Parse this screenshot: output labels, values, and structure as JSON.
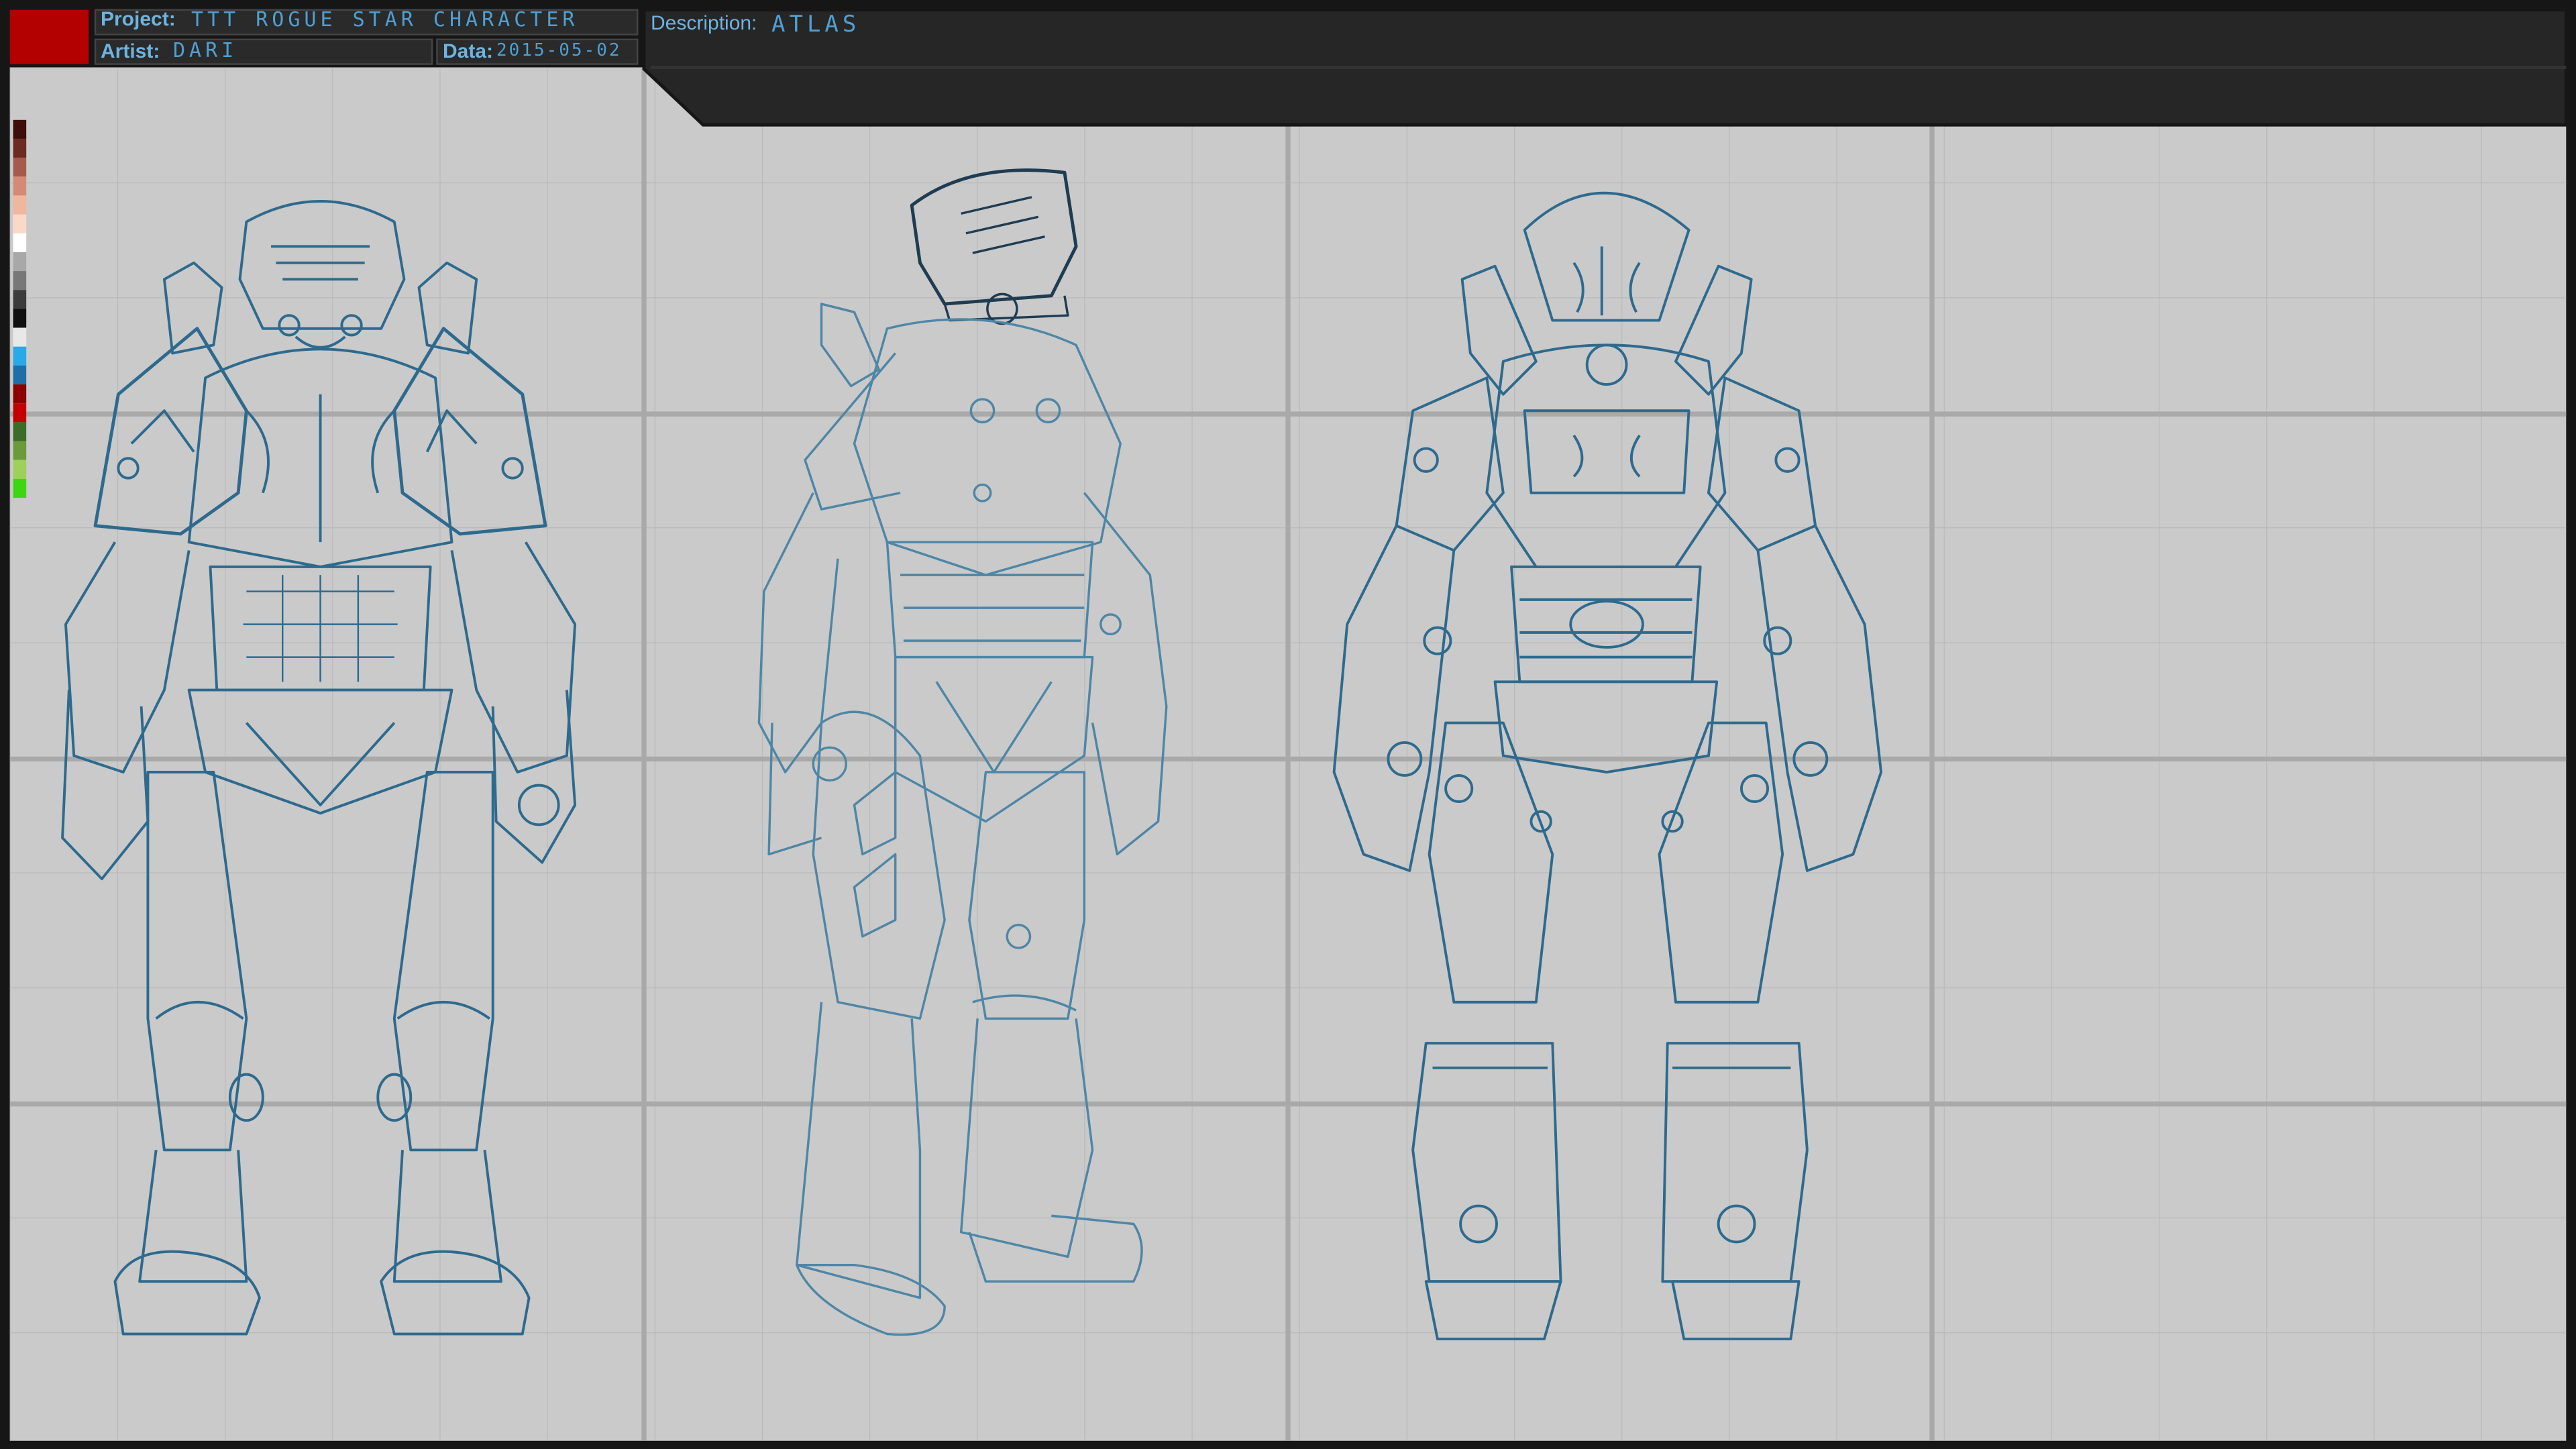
{
  "colors": {
    "frame": "#161616",
    "paper": "#cacaca",
    "grid_minor": "#b9b9b9",
    "grid_major": "#a9a9a9",
    "header_bg": "#262626",
    "label_text": "#6fb3df",
    "sketch_ink": "#2e6a8e",
    "sketch_ink_light": "#4f86a6",
    "accent_red": "#b30000"
  },
  "header": {
    "project_label": "Project:",
    "project_value": "TTT ROGUE STAR CHARACTER",
    "artist_label": "Artist:",
    "artist_value": "DARI",
    "date_label": "Data:",
    "date_value": "2015-05-02",
    "description_label": "Description:",
    "description_value": "ATLAS"
  },
  "palette": [
    "#3d0e0b",
    "#6b2b23",
    "#a65a4c",
    "#d48a76",
    "#f0b79f",
    "#fbd9c8",
    "#ffffff",
    "#a8a8a8",
    "#787878",
    "#3c3c3c",
    "#101010",
    "#e8e8e8",
    "#29a9e8",
    "#1f6ea8",
    "#8c0000",
    "#c30000",
    "#3d6b28",
    "#6c9a3a",
    "#9ed05a",
    "#3dd614"
  ],
  "views": [
    {
      "name": "front-view",
      "icon": "armored-character-front-icon"
    },
    {
      "name": "three-quarter-view",
      "icon": "armored-character-three-quarter-icon"
    },
    {
      "name": "back-view",
      "icon": "armored-character-back-icon"
    }
  ]
}
